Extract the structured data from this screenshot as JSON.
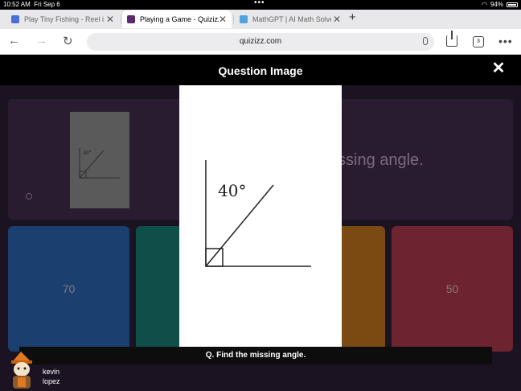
{
  "status_bar": {
    "time": "10:52 AM",
    "date": "Fri Sep 6",
    "dots": "•••",
    "battery_percent": "94%"
  },
  "tabs": [
    {
      "title": "Play Tiny Fishing - Reel i",
      "favicon_color": "#4a6fd8",
      "active": false
    },
    {
      "title": "Playing a Game - Quizizz",
      "favicon_color": "#5a2a6e",
      "active": true
    },
    {
      "title": "MathGPT | AI Math Solve",
      "favicon_color": "#4fa3e0",
      "active": false
    }
  ],
  "toolbar": {
    "url": "quizizz.com",
    "tab_count": "3"
  },
  "modal": {
    "title": "Question Image",
    "image_label": "40°",
    "question_text": "Q. Find the missing angle."
  },
  "background": {
    "question_fragment": "ssing angle.",
    "thumb_label": "40°",
    "options": [
      {
        "value": "70",
        "color": "#1b3f6e"
      },
      {
        "value": "",
        "color": "#0f4f4a"
      },
      {
        "value": "",
        "color": "#7a4a12"
      },
      {
        "value": "50",
        "color": "#6e2330"
      }
    ]
  },
  "player": {
    "first_name": "kevin",
    "last_name": "lopez"
  },
  "colors": {
    "page_background": "#1c1322",
    "header_background": "#000000"
  }
}
